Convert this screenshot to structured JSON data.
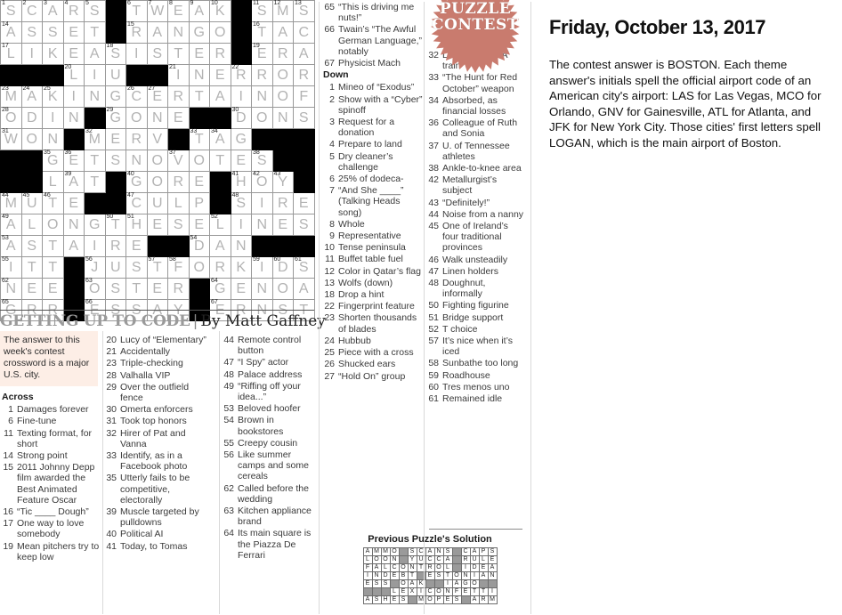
{
  "date_line": "Friday, October 13, 2017",
  "answer_paragraph": "The contest answer is BOSTON. Each theme answer's initials spell the official airport code of an American city's airport: LAS for Las Vegas, MCO for Orlando, GNV for Gainesville, ATL for Atlanta, and JFK for New York City. Those cities' first letters spell LOGAN, which is the main airport of Boston.",
  "badge": {
    "line1": "PUZZLE",
    "line2": "CONTEST",
    "color": "#c97b6e"
  },
  "puzzle": {
    "title": "GETTING UP TO CODE",
    "separator": "|",
    "byline": "By Matt Gaffney",
    "note": "The answer to this week's contest crossword is a major U.S. city.",
    "across_heading": "Across",
    "down_heading": "Down",
    "grid": {
      "rows": 15,
      "cols": 15,
      "letters": [
        [
          "S",
          "C",
          "A",
          "R",
          "S",
          "#",
          "T",
          "W",
          "E",
          "A",
          "K",
          "#",
          "S",
          "M",
          "S"
        ],
        [
          "A",
          "S",
          "S",
          "E",
          "T",
          "#",
          "R",
          "A",
          "N",
          "G",
          "O",
          "#",
          "T",
          "A",
          "C"
        ],
        [
          "L",
          "I",
          "K",
          "E",
          "A",
          "S",
          "I",
          "S",
          "T",
          "E",
          "R",
          "#",
          "E",
          "R",
          "A"
        ],
        [
          "#",
          "#",
          "#",
          "L",
          "I",
          "U",
          "#",
          "#",
          "I",
          "N",
          "E",
          "R",
          "R",
          "O",
          "R"
        ],
        [
          "M",
          "A",
          "K",
          "I",
          "N",
          "G",
          "C",
          "E",
          "R",
          "T",
          "A",
          "I",
          "N",
          "O",
          "F"
        ],
        [
          "O",
          "D",
          "I",
          "N",
          "#",
          "G",
          "O",
          "N",
          "E",
          "#",
          "#",
          "D",
          "O",
          "N",
          "S"
        ],
        [
          "W",
          "O",
          "N",
          "#",
          "M",
          "E",
          "R",
          "V",
          "#",
          "T",
          "A",
          "G",
          "#",
          "#",
          "#"
        ],
        [
          "#",
          "#",
          "G",
          "E",
          "T",
          "S",
          "N",
          "O",
          "V",
          "O",
          "T",
          "E",
          "S",
          "#",
          "#"
        ],
        [
          "#",
          "#",
          "L",
          "A",
          "T",
          "#",
          "G",
          "O",
          "R",
          "E",
          "#",
          "H",
          "O",
          "Y",
          "#"
        ],
        [
          "M",
          "U",
          "T",
          "E",
          "#",
          "#",
          "C",
          "U",
          "L",
          "P",
          "#",
          "S",
          "I",
          "R",
          "E"
        ],
        [
          "A",
          "L",
          "O",
          "N",
          "G",
          "T",
          "H",
          "E",
          "S",
          "E",
          "L",
          "I",
          "N",
          "E",
          "S"
        ],
        [
          "A",
          "S",
          "T",
          "A",
          "I",
          "R",
          "E",
          "#",
          "#",
          "D",
          "A",
          "N",
          "#",
          "#",
          "#"
        ],
        [
          "I",
          "T",
          "T",
          "#",
          "J",
          "U",
          "S",
          "T",
          "F",
          "O",
          "R",
          "K",
          "I",
          "D",
          "S"
        ],
        [
          "N",
          "E",
          "E",
          "#",
          "O",
          "S",
          "T",
          "E",
          "R",
          "#",
          "G",
          "E",
          "N",
          "O",
          "A"
        ],
        [
          "G",
          "R",
          "R",
          "#",
          "E",
          "S",
          "S",
          "A",
          "Y",
          "#",
          "E",
          "R",
          "N",
          "S",
          "T"
        ]
      ],
      "numbers": {
        "0-0": "1",
        "0-1": "2",
        "0-2": "3",
        "0-3": "4",
        "0-4": "5",
        "0-6": "6",
        "0-7": "7",
        "0-8": "8",
        "0-9": "9",
        "0-10": "10",
        "0-12": "11",
        "0-13": "12",
        "0-14": "13",
        "1-0": "14",
        "1-6": "15",
        "1-12": "16",
        "2-0": "17",
        "2-5": "18",
        "2-12": "19",
        "3-3": "20",
        "3-8": "21",
        "3-11": "22",
        "4-0": "23",
        "4-1": "24",
        "4-2": "25",
        "4-6": "26",
        "4-7": "27",
        "5-0": "28",
        "5-5": "29",
        "5-11": "30",
        "6-0": "31",
        "6-4": "32",
        "6-9": "33",
        "6-10": "34",
        "7-2": "35",
        "7-3": "36",
        "7-8": "37",
        "7-12": "38",
        "8-3": "39",
        "8-6": "40",
        "8-11": "41",
        "8-12": "42",
        "8-13": "43",
        "9-0": "44",
        "9-1": "45",
        "9-2": "46",
        "9-6": "47",
        "9-11": "48",
        "10-0": "49",
        "10-5": "50",
        "10-6": "51",
        "10-10": "52",
        "11-0": "53",
        "11-9": "54",
        "12-0": "55",
        "12-4": "56",
        "12-7": "57",
        "12-8": "58",
        "12-12": "59",
        "12-13": "60",
        "12-14": "61",
        "13-0": "62",
        "13-4": "63",
        "13-10": "64",
        "14-0": "65",
        "14-4": "66",
        "14-10": "67"
      }
    },
    "across": [
      {
        "n": "1",
        "t": "Damages forever"
      },
      {
        "n": "6",
        "t": "Fine-tune"
      },
      {
        "n": "11",
        "t": "Texting format, for short"
      },
      {
        "n": "14",
        "t": "Strong point"
      },
      {
        "n": "15",
        "t": "2011 Johnny Depp film awarded the Best Animated Feature Oscar"
      },
      {
        "n": "16",
        "t": "“Tic ____ Dough”"
      },
      {
        "n": "17",
        "t": "One way to love somebody"
      },
      {
        "n": "19",
        "t": "Mean pitchers try to keep low"
      },
      {
        "n": "20",
        "t": "Lucy of “Elementary”"
      },
      {
        "n": "21",
        "t": "Accidentally"
      },
      {
        "n": "23",
        "t": "Triple-checking"
      },
      {
        "n": "28",
        "t": "Valhalla VIP"
      },
      {
        "n": "29",
        "t": "Over the outfield fence"
      },
      {
        "n": "30",
        "t": "Omerta enforcers"
      },
      {
        "n": "31",
        "t": "Took top honors"
      },
      {
        "n": "32",
        "t": "Hirer of Pat and Vanna"
      },
      {
        "n": "33",
        "t": "Identify, as in a Facebook photo"
      },
      {
        "n": "35",
        "t": "Utterly fails to be competitive, electorally"
      },
      {
        "n": "39",
        "t": "Muscle targeted by pulldowns"
      },
      {
        "n": "40",
        "t": "Political AI"
      },
      {
        "n": "41",
        "t": "Today, to Tomas"
      },
      {
        "n": "44",
        "t": "Remote control button"
      },
      {
        "n": "47",
        "t": "“I Spy” actor"
      },
      {
        "n": "48",
        "t": "Palace address"
      },
      {
        "n": "49",
        "t": "“Riffing off your idea...”"
      },
      {
        "n": "53",
        "t": "Beloved hoofer"
      },
      {
        "n": "54",
        "t": "Brown in bookstores"
      },
      {
        "n": "55",
        "t": "Creepy cousin"
      },
      {
        "n": "56",
        "t": "Like summer camps and some cereals"
      },
      {
        "n": "62",
        "t": "Called before the wedding"
      },
      {
        "n": "63",
        "t": "Kitchen appliance brand"
      },
      {
        "n": "64",
        "t": "Its main square is the Piazza De Ferrari"
      },
      {
        "n": "65",
        "t": "“This is driving me nuts!”"
      },
      {
        "n": "66",
        "t": "Twain’s “The Awful German Language,” notably"
      },
      {
        "n": "67",
        "t": "Physicist Mach"
      }
    ],
    "down": [
      {
        "n": "1",
        "t": "Mineo of “Exodus”"
      },
      {
        "n": "2",
        "t": "Show with a “Cyber” spinoff"
      },
      {
        "n": "3",
        "t": "Request for a donation"
      },
      {
        "n": "4",
        "t": "Prepare to land"
      },
      {
        "n": "5",
        "t": "Dry cleaner’s challenge"
      },
      {
        "n": "6",
        "t": "25% of dodeca-"
      },
      {
        "n": "7",
        "t": "“And She ____” (Talking Heads song)"
      },
      {
        "n": "8",
        "t": "Whole"
      },
      {
        "n": "9",
        "t": "Representative"
      },
      {
        "n": "10",
        "t": "Tense peninsula"
      },
      {
        "n": "11",
        "t": "Buffet table fuel"
      },
      {
        "n": "12",
        "t": "Color in Qatar’s flag"
      },
      {
        "n": "13",
        "t": "Wolfs (down)"
      },
      {
        "n": "18",
        "t": "Drop a hint"
      },
      {
        "n": "22",
        "t": "Fingerprint feature"
      },
      {
        "n": "23",
        "t": "Shorten thousands of blades"
      },
      {
        "n": "24",
        "t": "Hubbub"
      },
      {
        "n": "25",
        "t": "Piece with a cross"
      },
      {
        "n": "26",
        "t": "Shucked ears"
      },
      {
        "n": "27",
        "t": "“Hold On” group"
      },
      {
        "n": "32",
        "t": "Letters on the A train"
      },
      {
        "n": "33",
        "t": "“The Hunt for Red October” weapon"
      },
      {
        "n": "34",
        "t": "Absorbed, as financial losses"
      },
      {
        "n": "36",
        "t": "Colleague of Ruth and Sonia"
      },
      {
        "n": "37",
        "t": "U. of Tennessee athletes"
      },
      {
        "n": "38",
        "t": "Ankle-to-knee area"
      },
      {
        "n": "42",
        "t": "Metallurgist’s subject"
      },
      {
        "n": "43",
        "t": "“Definitely!”"
      },
      {
        "n": "44",
        "t": "Noise from a nanny"
      },
      {
        "n": "45",
        "t": "One of Ireland’s four traditional provinces"
      },
      {
        "n": "46",
        "t": "Walk unsteadily"
      },
      {
        "n": "47",
        "t": "Linen holders"
      },
      {
        "n": "48",
        "t": "Doughnut, informally"
      },
      {
        "n": "50",
        "t": "Fighting figurine"
      },
      {
        "n": "51",
        "t": "Bridge support"
      },
      {
        "n": "52",
        "t": "T choice"
      },
      {
        "n": "57",
        "t": "It’s nice when it’s iced"
      },
      {
        "n": "58",
        "t": "Sunbathe too long"
      },
      {
        "n": "59",
        "t": "Roadhouse"
      },
      {
        "n": "60",
        "t": "Tres menos uno"
      },
      {
        "n": "61",
        "t": "Remained idle"
      }
    ]
  },
  "previous_solution": {
    "title": "Previous Puzzle's Solution",
    "letters": [
      [
        "A",
        "M",
        "M",
        "O",
        "#",
        "S",
        "C",
        "A",
        "N",
        "S",
        "#",
        "C",
        "A",
        "P",
        "S"
      ],
      [
        "L",
        "O",
        "O",
        "N",
        "#",
        "Y",
        "U",
        "C",
        "C",
        "A",
        "#",
        "R",
        "U",
        "L",
        "E"
      ],
      [
        "F",
        "A",
        "L",
        "C",
        "O",
        "N",
        "T",
        "R",
        "O",
        "L",
        "#",
        "I",
        "D",
        "E",
        "A"
      ],
      [
        "I",
        "N",
        "D",
        "E",
        "B",
        "T",
        "#",
        "E",
        "S",
        "T",
        "O",
        "N",
        "I",
        "A",
        "N"
      ],
      [
        "E",
        "S",
        "S",
        "#",
        "O",
        "A",
        "K",
        "#",
        "#",
        "I",
        "A",
        "G",
        "O",
        "#",
        "#"
      ],
      [
        "#",
        "#",
        "#",
        "L",
        "E",
        "X",
        "I",
        "C",
        "O",
        "N",
        "F",
        "E",
        "T",
        "T",
        "I"
      ],
      [
        "A",
        "S",
        "H",
        "E",
        "S",
        "#",
        "M",
        "O",
        "P",
        "E",
        "S",
        "#",
        "A",
        "R",
        "M"
      ]
    ]
  }
}
